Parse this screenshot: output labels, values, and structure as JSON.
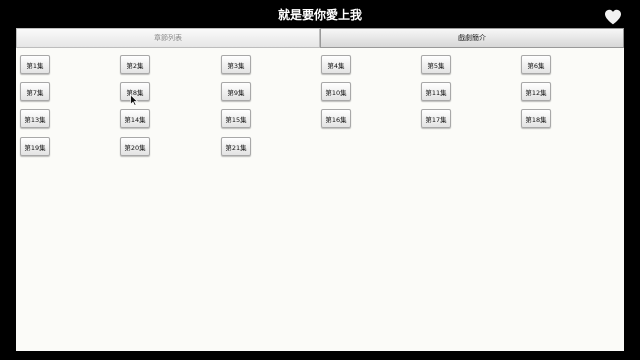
{
  "app": {
    "title": "就是要你愛上我",
    "heart_icon": "heart-icon"
  },
  "tabs": [
    {
      "label": "章節列表",
      "active": false
    },
    {
      "label": "戲劇簡介",
      "active": true
    }
  ],
  "episodes": [
    "第1集",
    "第2集",
    "第3集",
    "第4集",
    "第5集",
    "第6集",
    "第7集",
    "第8集",
    "第9集",
    "第10集",
    "第11集",
    "第12集",
    "第13集",
    "第14集",
    "第15集",
    "第16集",
    "第17集",
    "第18集",
    "第19集",
    "第20集",
    "第21集"
  ],
  "colors": {
    "background": "#000000",
    "content": "#fbfbf8"
  }
}
